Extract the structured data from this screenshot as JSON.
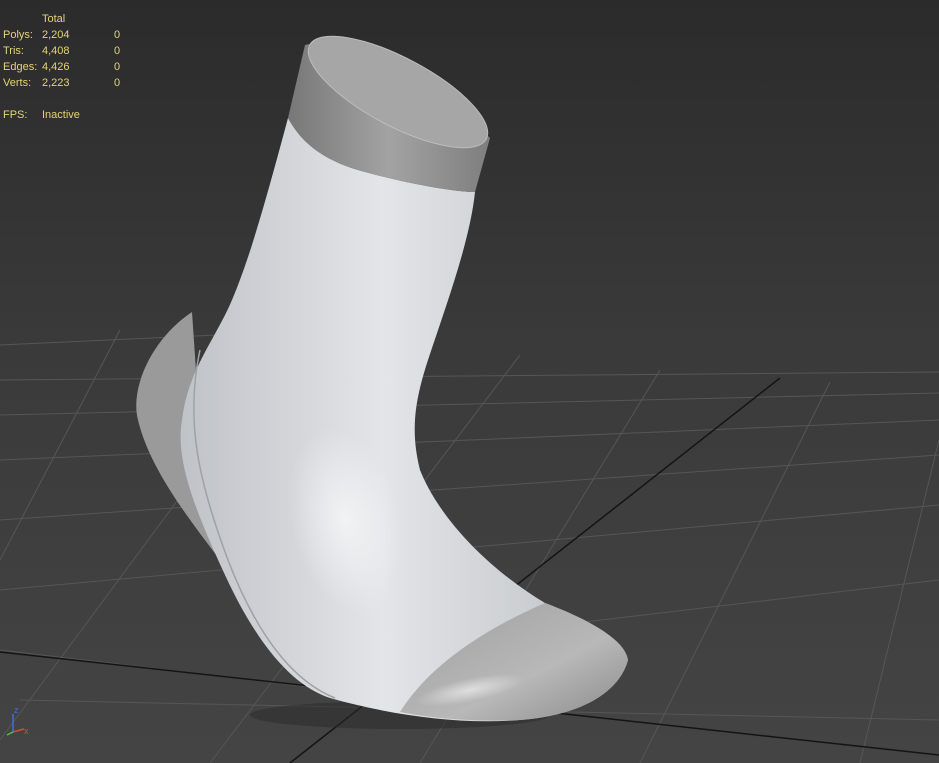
{
  "stats": {
    "header": "Total",
    "rows": [
      {
        "label": "Polys:",
        "total": "2,204",
        "selected": "0"
      },
      {
        "label": "Tris:",
        "total": "4,408",
        "selected": "0"
      },
      {
        "label": "Edges:",
        "total": "4,426",
        "selected": "0"
      },
      {
        "label": "Verts:",
        "total": "2,223",
        "selected": "0"
      }
    ],
    "fps_label": "FPS:",
    "fps_value": "Inactive"
  },
  "axis_gizmo": {
    "z_label": "z",
    "x_label": "x",
    "z_color": "#3a6ee8",
    "x_color": "#d84a3a",
    "y_color": "#4fbf4f"
  },
  "colors": {
    "background_top": "#2b2b2b",
    "background_bottom": "#444444",
    "grid_line": "#555555",
    "grid_axis": "#111111",
    "stats_text": "#e6d27a",
    "sock_body": "#cfd2d6",
    "sock_band": "#8e8e8e"
  }
}
